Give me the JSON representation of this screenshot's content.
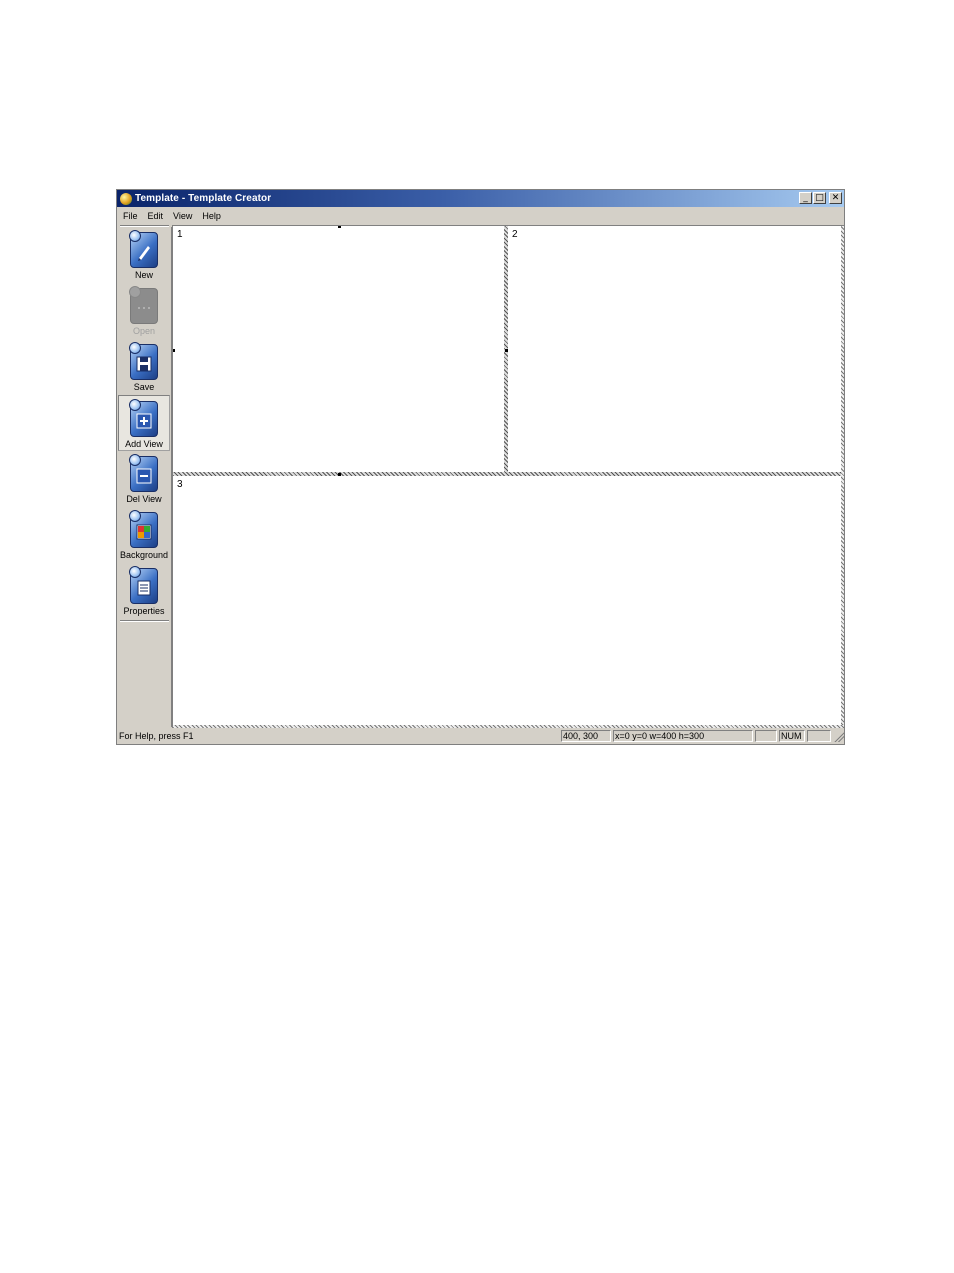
{
  "window": {
    "title": "Template - Template Creator"
  },
  "titlebar_buttons": {
    "minimize": "_",
    "maximize": "□",
    "close": "✕"
  },
  "menu": [
    "File",
    "Edit",
    "View",
    "Help"
  ],
  "toolbar": [
    {
      "label": "New",
      "icon": "new-doc-icon",
      "enabled": true
    },
    {
      "label": "Open",
      "icon": "open-doc-icon",
      "enabled": false
    },
    {
      "label": "Save",
      "icon": "save-disk-icon",
      "enabled": true
    },
    {
      "label": "Add View",
      "icon": "add-view-icon",
      "enabled": true,
      "pressed": true
    },
    {
      "label": "Del View",
      "icon": "del-view-icon",
      "enabled": true
    },
    {
      "label": "Background",
      "icon": "background-icon",
      "enabled": true
    },
    {
      "label": "Properties",
      "icon": "properties-icon",
      "enabled": true
    }
  ],
  "views": [
    {
      "label": "1"
    },
    {
      "label": "2"
    },
    {
      "label": "3"
    }
  ],
  "status": {
    "help": "For Help, press F1",
    "position": "400, 300",
    "geometry": "x=0 y=0 w=400 h=300",
    "cap": "",
    "num": "NUM",
    "scrl": ""
  },
  "colors": {
    "title_start": "#0a246a",
    "title_end": "#a6caf0",
    "chrome": "#d4d0c8"
  }
}
